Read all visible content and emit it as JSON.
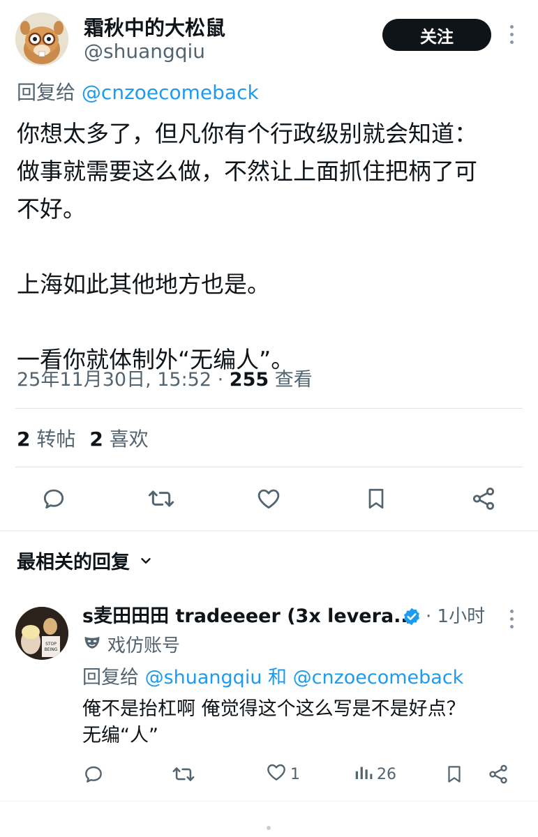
{
  "tweet": {
    "display_name": "霜秋中的大松鼠",
    "handle": "@shuangqiu",
    "follow_label": "关注",
    "reply_to_prefix": "回复给",
    "reply_to_mention": "@cnzoecomeback",
    "body": "你想太多了，但凡你有个行政级别就会知道：\n做事就需要这么做，不然让上面抓住把柄了可\n不好。\n\n上海如此其他地方也是。\n\n一看你就体制外“无编人”。",
    "timestamp": "25年11月30日, 15:52 · ",
    "views_count": "255",
    "views_label": " 查看",
    "retweets_count": "2",
    "retweets_label": "转帖",
    "likes_count": "2",
    "likes_label": "喜欢"
  },
  "actions": [
    "reply-icon",
    "retweet-icon",
    "like-icon",
    "bookmark-icon",
    "share-icon"
  ],
  "relevant_replies": {
    "label": "最相关的回复"
  },
  "reply": {
    "display_name": "s麦田田田 tradeeeer (3x levera...",
    "time": "· 1小时",
    "parody_label": "戏仿账号",
    "reply_to_prefix": "回复给",
    "reply_to_mention_1": "@shuangqiu",
    "reply_to_and": " 和 ",
    "reply_to_mention_2": "@cnzoecomeback",
    "body": "俺不是抬杠啊 俺觉得这个这么写是不是好点？\n无编“人”",
    "like_count": "1",
    "views_count": "26"
  },
  "colors": {
    "accent": "#1d9bf0",
    "text": "#0f1419",
    "muted": "#536471"
  }
}
